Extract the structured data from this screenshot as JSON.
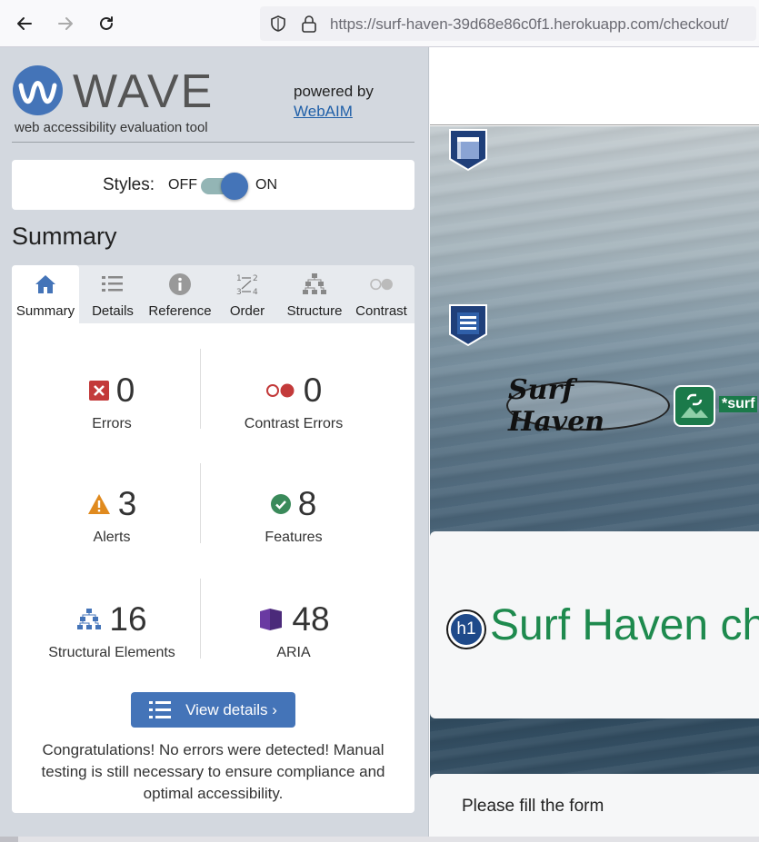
{
  "browser": {
    "url_host": "https://surf-haven-39d68e86c0f1.herokuapp.com",
    "url_path": "/checkout/"
  },
  "wave": {
    "logo_text": "WAVE",
    "tagline": "web accessibility evaluation tool",
    "powered_by": "powered by",
    "webaim_link": "WebAIM",
    "styles_label": "Styles:",
    "styles_off": "OFF",
    "styles_on": "ON",
    "summary_heading": "Summary",
    "tabs": [
      {
        "label": "Summary",
        "icon": "home-icon",
        "active": true
      },
      {
        "label": "Details",
        "icon": "list-icon",
        "active": false
      },
      {
        "label": "Reference",
        "icon": "info-icon",
        "active": false
      },
      {
        "label": "Order",
        "icon": "order-icon",
        "active": false
      },
      {
        "label": "Structure",
        "icon": "structure-icon",
        "active": false
      },
      {
        "label": "Contrast",
        "icon": "contrast-icon",
        "active": false
      }
    ],
    "stats": {
      "errors": {
        "count": "0",
        "label": "Errors"
      },
      "contrast_errors": {
        "count": "0",
        "label": "Contrast Errors"
      },
      "alerts": {
        "count": "3",
        "label": "Alerts"
      },
      "features": {
        "count": "8",
        "label": "Features"
      },
      "structural": {
        "count": "16",
        "label": "Structural Elements"
      },
      "aria": {
        "count": "48",
        "label": "ARIA"
      }
    },
    "view_details": "View details ›",
    "congrats": "Congratulations! No errors were detected! Manual testing is still necessary to ensure compliance and optimal accessibility."
  },
  "page": {
    "logo_text": "Surf Haven",
    "alt_text": "*surf",
    "h1_badge": "h1",
    "title": "Surf Haven ch",
    "form_prompt": "Please fill the form"
  },
  "colors": {
    "wave_blue": "#4474b8",
    "error_red": "#c33a3a",
    "alert_orange": "#e08a1e",
    "feature_green": "#3a8a5a",
    "aria_purple": "#4b2a7a",
    "page_title_green": "#1e8a4e"
  }
}
